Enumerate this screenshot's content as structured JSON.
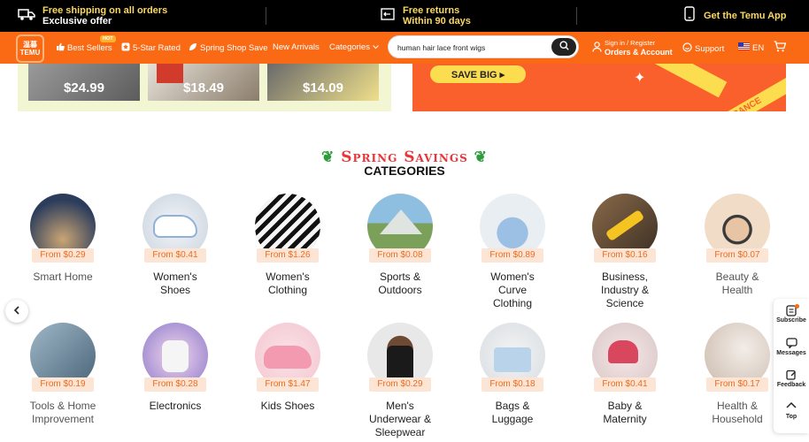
{
  "promo": {
    "shipping_title": "Free shipping on all orders",
    "shipping_sub": "Exclusive offer",
    "returns_title": "Free returns",
    "returns_sub": "Within 90 days",
    "app_label": "Get the Temu App"
  },
  "nav": {
    "logo_line1": "温暮",
    "logo_line2": "TEMU",
    "best_sellers": "Best Sellers",
    "hot_badge": "HOT",
    "five_star": "5-Star Rated",
    "spring_save": "Spring Shop Save",
    "new_arrivals": "New Arrivals",
    "categories": "Categories",
    "sign_in": "Sign in / Register",
    "orders_account": "Orders & Account",
    "support": "Support",
    "language": "EN"
  },
  "search": {
    "value": "human hair lace front wigs"
  },
  "banner": {
    "prices": [
      "$24.99",
      "$18.49",
      "$14.09"
    ],
    "save_big": "SAVE BIG ▸",
    "clearance_text": "CLEARANCE"
  },
  "headline": {
    "title": "Spring Savings",
    "subtitle": "CATEGORIES"
  },
  "categories_row1": [
    {
      "name": "Smart Home",
      "price": "From $0.29"
    },
    {
      "name": "Women's Shoes",
      "price": "From $0.41"
    },
    {
      "name": "Women's Clothing",
      "price": "From $1.26"
    },
    {
      "name": "Sports & Outdoors",
      "price": "From $0.08"
    },
    {
      "name": "Women's Curve Clothing",
      "price": "From $0.89"
    },
    {
      "name": "Business, Industry & Science",
      "price": "From $0.16"
    },
    {
      "name": "Beauty & Health",
      "price": "From $0.07"
    }
  ],
  "categories_row2": [
    {
      "name": "Tools & Home Improvement",
      "price": "From $0.19"
    },
    {
      "name": "Electronics",
      "price": "From $0.28"
    },
    {
      "name": "Kids Shoes",
      "price": "From $1.47"
    },
    {
      "name": "Men's Underwear & Sleepwear",
      "price": "From $0.29"
    },
    {
      "name": "Bags & Luggage",
      "price": "From $0.18"
    },
    {
      "name": "Baby & Maternity",
      "price": "From $0.41"
    },
    {
      "name": "Health & Household",
      "price": "From $0.17"
    }
  ],
  "side_panel": {
    "subscribe": "Subscribe",
    "messages": "Messages",
    "feedback": "Feedback",
    "top": "Top"
  },
  "colors": {
    "brand_orange": "#fa6a15",
    "promo_yellow": "#fbd85e",
    "price_orange": "#f06a1b",
    "headline_red": "#e8353b"
  }
}
